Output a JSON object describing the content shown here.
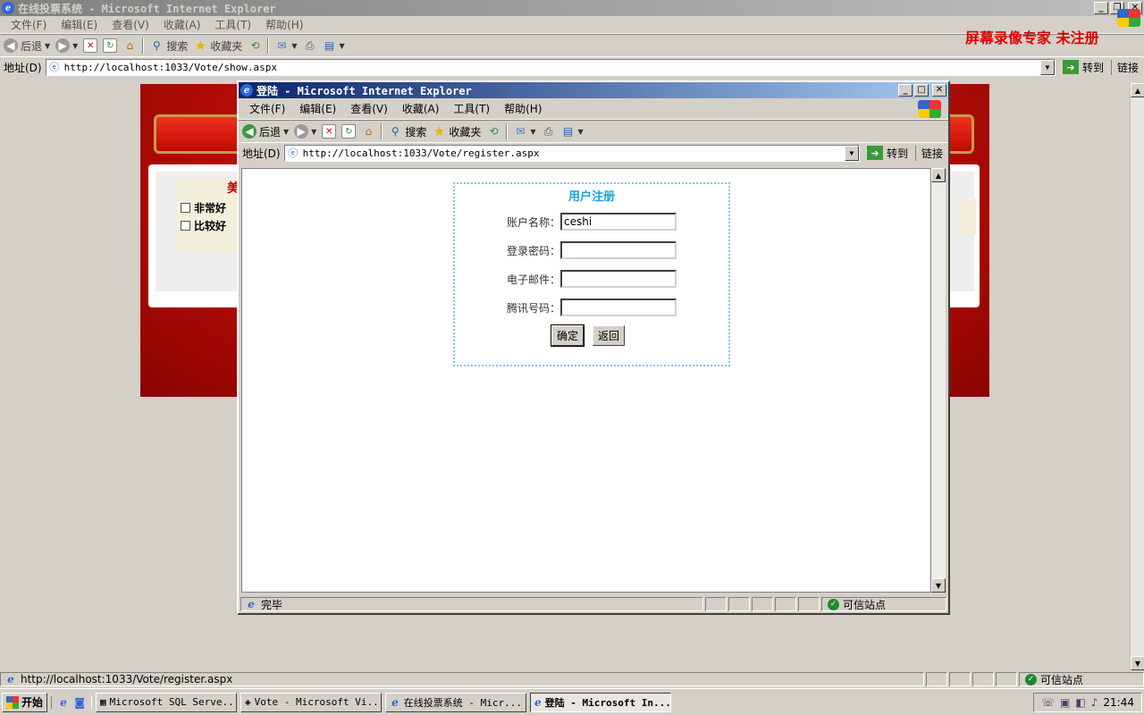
{
  "outer": {
    "title": "在线投票系统 - Microsoft Internet Explorer",
    "menu": [
      "文件(F)",
      "编辑(E)",
      "查看(V)",
      "收藏(A)",
      "工具(T)",
      "帮助(H)"
    ],
    "toolbar": {
      "back": "后退",
      "search": "搜索",
      "favorites": "收藏夹"
    },
    "address_label": "地址(D)",
    "address": "http://localhost:1033/Vote/show.aspx",
    "go": "转到",
    "links": "链接",
    "status": "http://localhost:1033/Vote/register.aspx",
    "zone": "可信站点"
  },
  "background_page": {
    "vote_title": "美",
    "options": [
      "非常好",
      "比较好"
    ]
  },
  "popup": {
    "title": "登陆 - Microsoft Internet Explorer",
    "menu": [
      "文件(F)",
      "编辑(E)",
      "查看(V)",
      "收藏(A)",
      "工具(T)",
      "帮助(H)"
    ],
    "toolbar": {
      "back": "后退",
      "search": "搜索",
      "favorites": "收藏夹"
    },
    "address_label": "地址(D)",
    "address": "http://localhost:1033/Vote/register.aspx",
    "go": "转到",
    "links": "链接",
    "status": "完毕",
    "zone": "可信站点"
  },
  "form": {
    "title": "用户注册",
    "fields": [
      {
        "label": "账户名称：",
        "value": "ceshi"
      },
      {
        "label": "登录密码：",
        "value": ""
      },
      {
        "label": "电子邮件：",
        "value": ""
      },
      {
        "label": "腾讯号码：",
        "value": ""
      }
    ],
    "submit": "确定",
    "back": "返回"
  },
  "watermark": "屏幕录像专家 未注册",
  "taskbar": {
    "start": "开始",
    "tasks": [
      "Microsoft SQL Serve...",
      "Vote - Microsoft Vi...",
      "在线投票系统 - Micr...",
      "登陆 - Microsoft In..."
    ],
    "clock": "21:44"
  }
}
